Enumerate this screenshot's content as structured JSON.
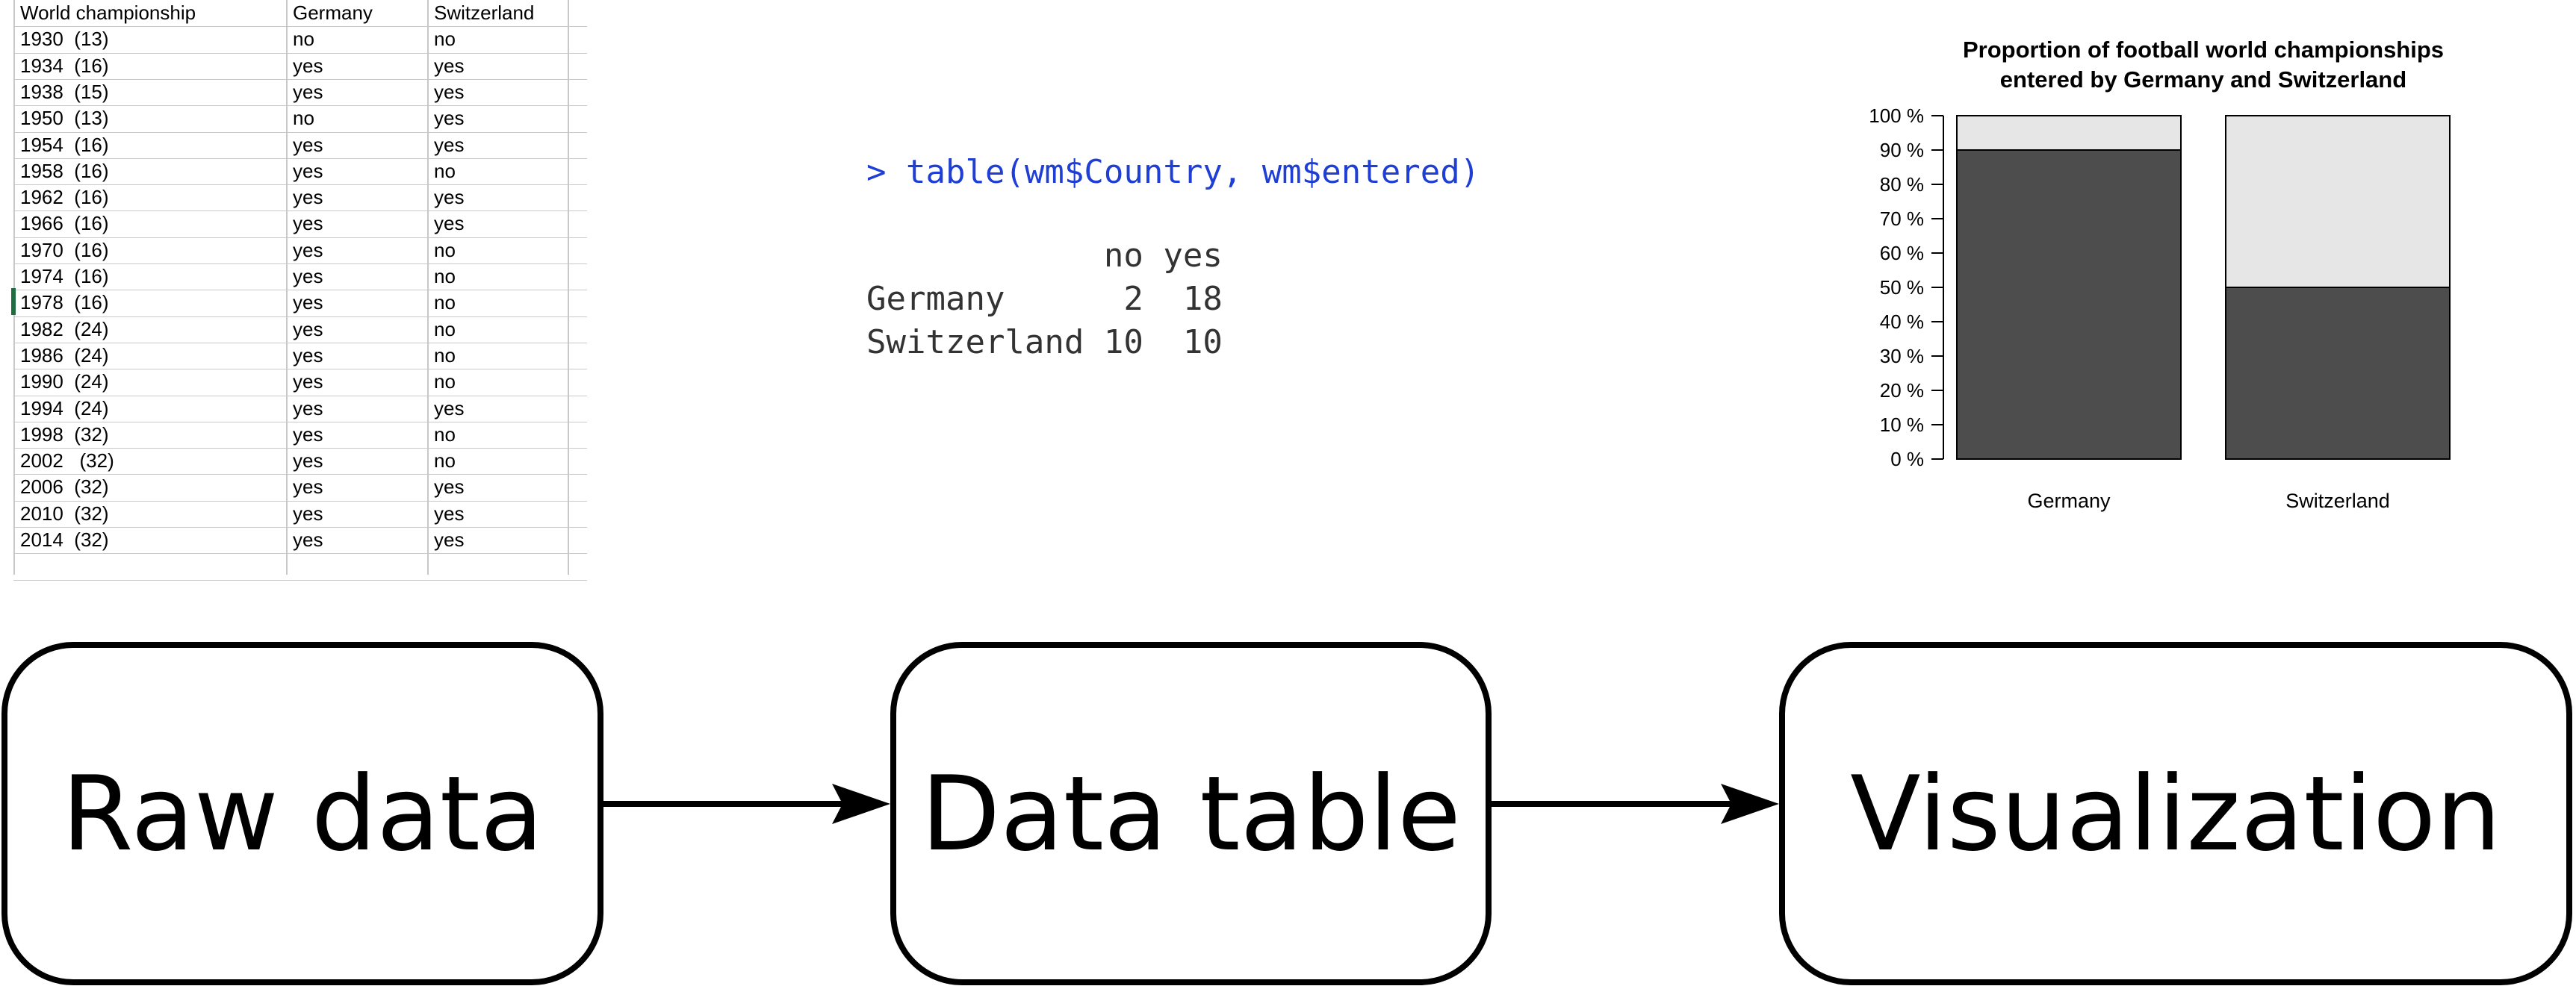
{
  "raw_sheet": {
    "headers": [
      "World championship",
      "Germany",
      "Switzerland"
    ],
    "rows": [
      [
        "1930  (13)",
        "no",
        "no"
      ],
      [
        "1934  (16)",
        "yes",
        "yes"
      ],
      [
        "1938  (15)",
        "yes",
        "yes"
      ],
      [
        "1950  (13)",
        "no",
        "yes"
      ],
      [
        "1954  (16)",
        "yes",
        "yes"
      ],
      [
        "1958  (16)",
        "yes",
        "no"
      ],
      [
        "1962  (16)",
        "yes",
        "yes"
      ],
      [
        "1966  (16)",
        "yes",
        "yes"
      ],
      [
        "1970  (16)",
        "yes",
        "no"
      ],
      [
        "1974  (16)",
        "yes",
        "no"
      ],
      [
        "1978  (16)",
        "yes",
        "no"
      ],
      [
        "1982  (24)",
        "yes",
        "no"
      ],
      [
        "1986  (24)",
        "yes",
        "no"
      ],
      [
        "1990  (24)",
        "yes",
        "no"
      ],
      [
        "1994  (24)",
        "yes",
        "yes"
      ],
      [
        "1998  (32)",
        "yes",
        "no"
      ],
      [
        "2002   (32)",
        "yes",
        "no"
      ],
      [
        "2006  (32)",
        "yes",
        "yes"
      ],
      [
        "2010  (32)",
        "yes",
        "yes"
      ],
      [
        "2014  (32)",
        "yes",
        "yes"
      ]
    ]
  },
  "r_console": {
    "command": "> table(wm$Country, wm$entered)",
    "header_line": "            no yes",
    "row1": "Germany      2  18",
    "row2": "Switzerland 10  10"
  },
  "chart_data": {
    "type": "bar",
    "stacked": true,
    "title": "Proportion of football world championships\nentered by Germany and Switzerland",
    "categories": [
      "Germany",
      "Switzerland"
    ],
    "series": [
      {
        "values": [
          90,
          50
        ],
        "color": "#4d4d4d"
      },
      {
        "values": [
          10,
          50
        ],
        "color": "#e6e6e6"
      }
    ],
    "ylim": [
      0,
      100
    ],
    "yticks": [
      "0 %",
      "10 %",
      "20 %",
      "30 %",
      "40 %",
      "50 %",
      "60 %",
      "70 %",
      "80 %",
      "90 %",
      "100 %"
    ],
    "grid": false
  },
  "pipeline": {
    "steps": [
      "Raw data",
      "Data table",
      "Visualization"
    ]
  }
}
